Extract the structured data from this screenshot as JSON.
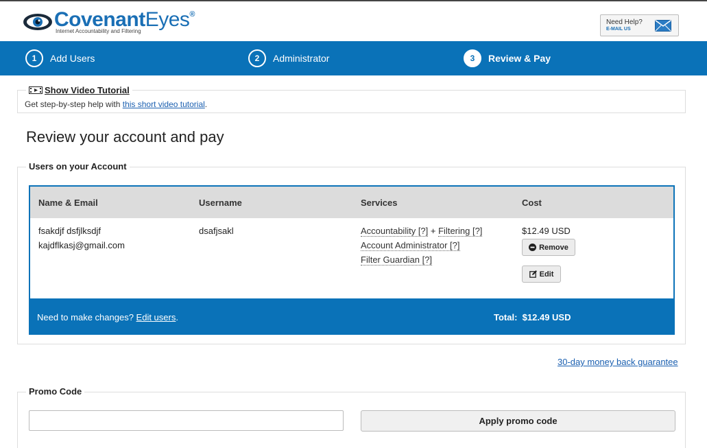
{
  "brand": {
    "name_bold": "Covenant",
    "name_thin": "Eyes",
    "registered": "®",
    "tagline": "Internet Accountability and Filtering"
  },
  "help": {
    "line1": "Need Help?",
    "line2": "E-MAIL US"
  },
  "steps": [
    {
      "num": "1",
      "label": "Add Users",
      "active": false
    },
    {
      "num": "2",
      "label": "Administrator",
      "active": false
    },
    {
      "num": "3",
      "label": "Review & Pay",
      "active": true
    }
  ],
  "tutorial": {
    "title": "Show Video Tutorial",
    "text": "Get step-by-step help with ",
    "link": "this short video tutorial",
    "after": "."
  },
  "page_title": "Review your account and pay",
  "users_section": {
    "legend": "Users on your Account",
    "columns": [
      "Name & Email",
      "Username",
      "Services",
      "Cost"
    ],
    "rows": [
      {
        "name": "fsakdjf dsfjlksdjf",
        "email": "kajdflkasj@gmail.com",
        "username": "dsafjsakl",
        "services": {
          "accountability": "Accountability [?]",
          "plus": " + ",
          "filtering": "Filtering [?]",
          "admin": "Account Administrator [?]",
          "guardian": "Filter Guardian [?]"
        },
        "cost": "$12.49 USD",
        "remove_label": "Remove",
        "edit_label": "Edit"
      }
    ],
    "footer_note": "Need to make changes? ",
    "footer_link": "Edit users",
    "footer_after": ".",
    "total_label": "Total:",
    "total_value": "$12.49 USD"
  },
  "guarantee": "30-day money back guarantee",
  "promo": {
    "legend": "Promo Code",
    "input_value": "",
    "input_placeholder": "",
    "button": "Apply promo code"
  },
  "colors": {
    "primary": "#0a72b8",
    "brand": "#1a6fb5",
    "link": "#1a5fb0"
  }
}
